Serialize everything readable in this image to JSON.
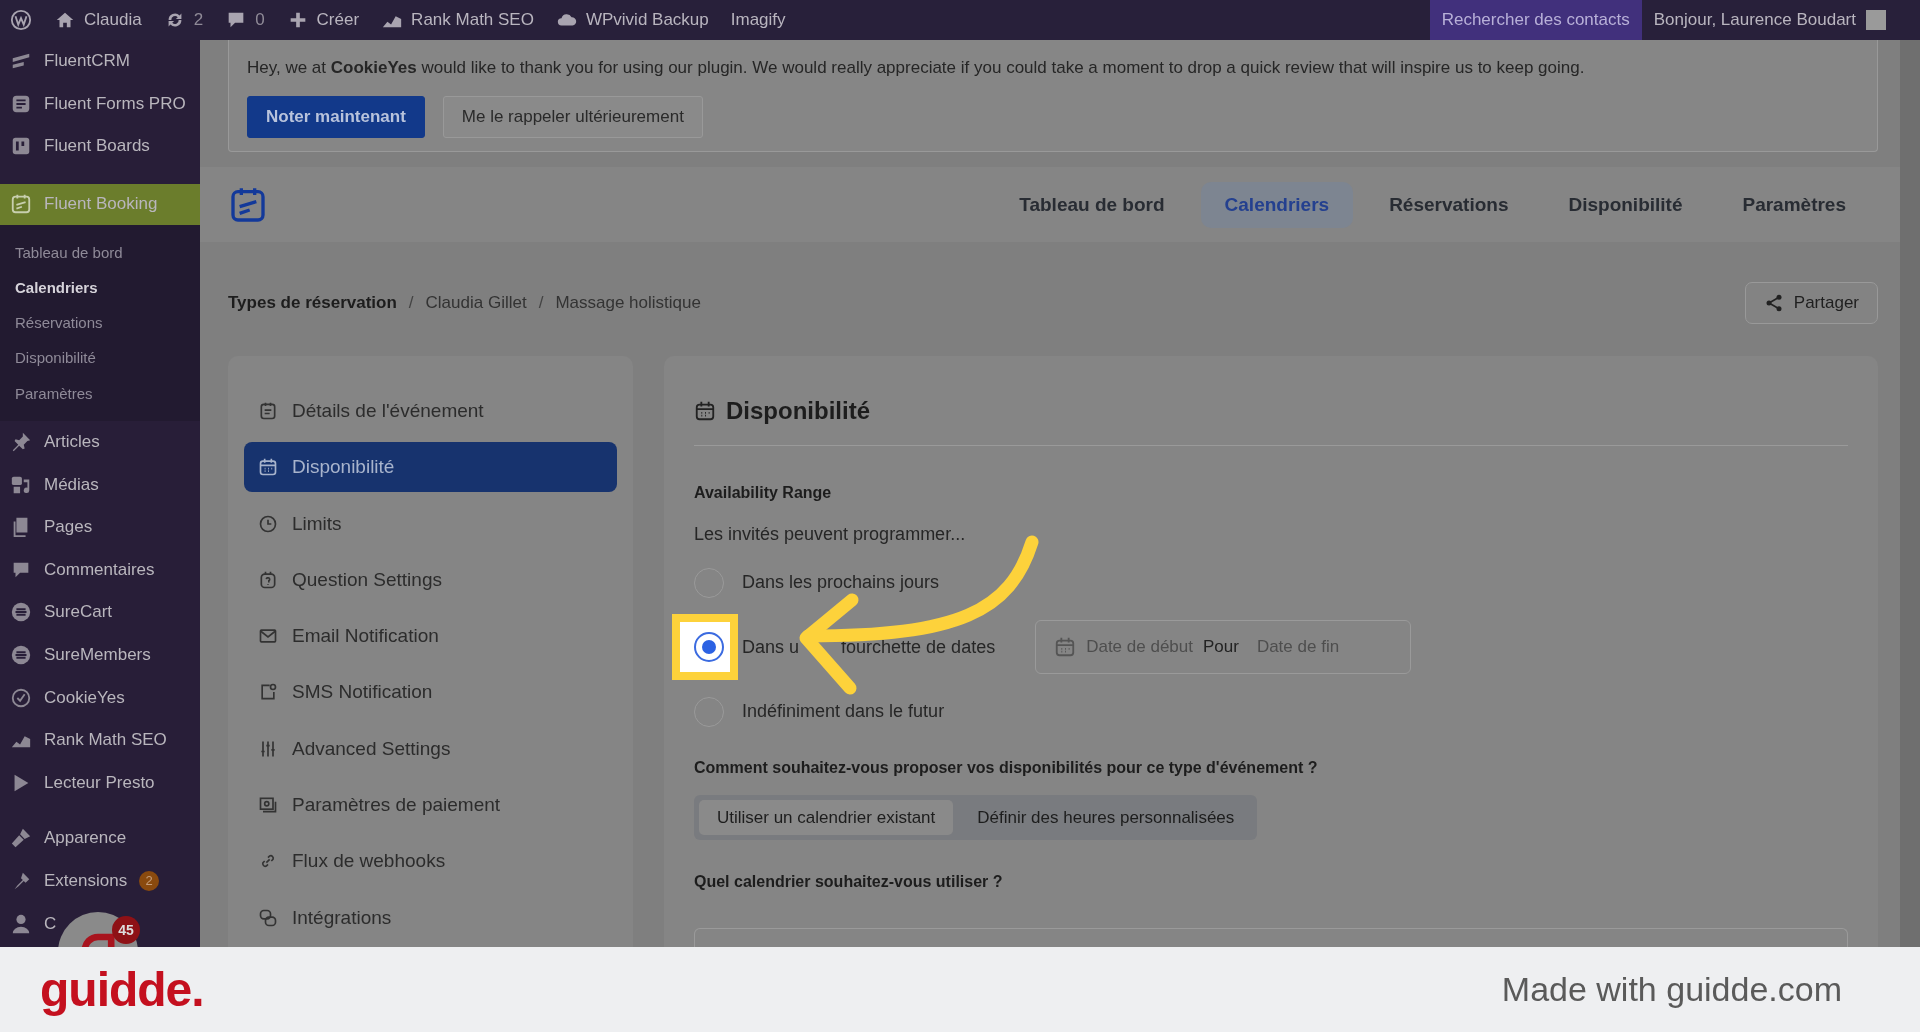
{
  "admin_bar": {
    "left": [
      {
        "label": "Claudia"
      },
      {
        "label": "2"
      },
      {
        "label": "0"
      },
      {
        "label": "Créer"
      },
      {
        "label": "Rank Math SEO"
      },
      {
        "label": "WPvivid Backup"
      },
      {
        "label": "Imagify"
      }
    ],
    "search": "Rechercher des contacts",
    "greeting": "Bonjour, Laurence Boudart"
  },
  "sidebar": {
    "items": [
      {
        "label": "FluentCRM",
        "selected": false
      },
      {
        "label": "Fluent Forms PRO",
        "selected": false
      },
      {
        "label": "Fluent Boards",
        "selected": false
      },
      {
        "label": "Fluent Booking",
        "selected": true,
        "children": [
          {
            "label": "Tableau de bord",
            "selected": false
          },
          {
            "label": "Calendriers",
            "selected": true
          },
          {
            "label": "Réservations",
            "selected": false
          },
          {
            "label": "Disponibilité",
            "selected": false
          },
          {
            "label": "Paramètres",
            "selected": false
          }
        ]
      },
      {
        "label": "Articles",
        "selected": false
      },
      {
        "label": "Médias",
        "selected": false
      },
      {
        "label": "Pages",
        "selected": false
      },
      {
        "label": "Commentaires",
        "selected": false
      },
      {
        "label": "SureCart",
        "selected": false
      },
      {
        "label": "SureMembers",
        "selected": false
      },
      {
        "label": "CookieYes",
        "selected": false
      },
      {
        "label": "Rank Math SEO",
        "selected": false
      },
      {
        "label": "Lecteur Presto",
        "selected": false
      },
      {
        "label": "Apparence",
        "selected": false
      },
      {
        "label": "Extensions",
        "selected": false,
        "badge": "2"
      },
      {
        "label": "C",
        "selected": false
      }
    ]
  },
  "chat_bubble": {
    "badge": "45"
  },
  "notice": {
    "text": "Hey, we at **CookieYes** would like to thank you for using our plugin. We would really appreciate if you could take a moment to drop a quick review that will inspire us to keep going.",
    "buttons": [
      "Noter maintenant",
      "Me le rappeler ultérieurement"
    ]
  },
  "nav_tabs": [
    {
      "label": "Tableau de bord",
      "selected": false
    },
    {
      "label": "Calendriers",
      "selected": true
    },
    {
      "label": "Réservations",
      "selected": false
    },
    {
      "label": "Disponibilité",
      "selected": false
    },
    {
      "label": "Paramètres",
      "selected": false
    }
  ],
  "breadcrumb": {
    "items": [
      "Types de réservation",
      "Claudia Gillet",
      "Massage holistique"
    ],
    "separators": [
      "/",
      "/"
    ]
  },
  "share_button": "Partager",
  "settings_menu": [
    {
      "label": "Détails de l'événement",
      "selected": false
    },
    {
      "label": "Disponibilité",
      "selected": true
    },
    {
      "label": "Limits",
      "selected": false
    },
    {
      "label": "Question Settings",
      "selected": false
    },
    {
      "label": "Email Notification",
      "selected": false
    },
    {
      "label": "SMS Notification",
      "selected": false
    },
    {
      "label": "Advanced Settings",
      "selected": false
    },
    {
      "label": "Paramètres de paiement",
      "selected": false
    },
    {
      "label": "Flux de webhooks",
      "selected": false
    },
    {
      "label": "Intégrations",
      "selected": false
    }
  ],
  "panel": {
    "title": "Disponibilité",
    "range_label": "Availability Range",
    "range_hint": "Les invités peuvent programmer...",
    "options": [
      {
        "label": "Dans les prochains jours",
        "selected": false,
        "highlighted": false
      },
      {
        "label": "Dans u",
        "label_tail": "fourchette de dates",
        "selected": true,
        "highlighted": true,
        "date_range": {
          "start_placeholder": "Date de début",
          "separator": "Pour",
          "end_placeholder": "Date de fin"
        }
      },
      {
        "label": "Indéfiniment dans le futur",
        "selected": false,
        "highlighted": false
      }
    ],
    "method_question": "Comment souhaitez-vous proposer vos disponibilités pour ce type d'événement ?",
    "method_options": [
      {
        "label": "Utiliser un calendrier existant",
        "selected": true
      },
      {
        "label": "Définir des heures personnalisées",
        "selected": false
      }
    ],
    "calendar_question": "Quel calendrier souhaitez-vous utiliser ?"
  },
  "footer": {
    "logo": "guidde.",
    "credit": "Made with guidde.com"
  }
}
